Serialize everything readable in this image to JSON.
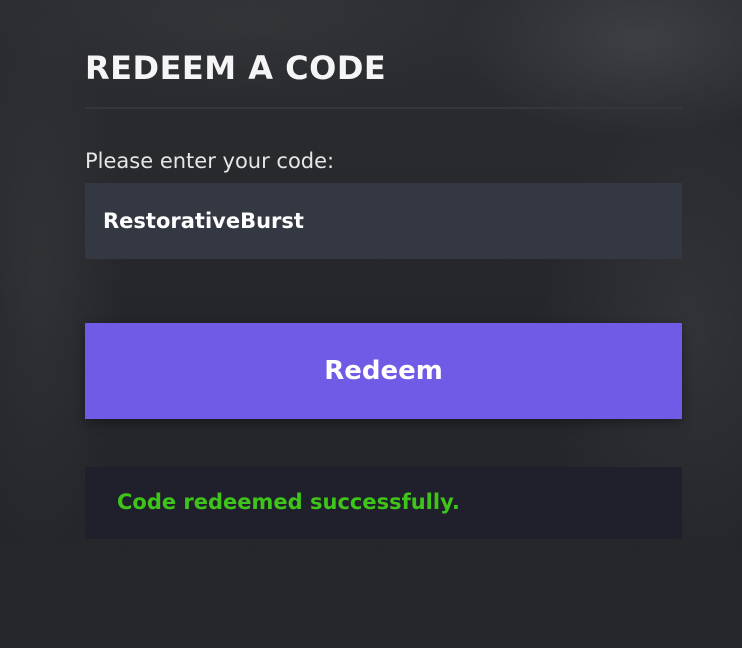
{
  "redeem": {
    "title": "REDEEM A CODE",
    "input_label": "Please enter your code:",
    "code_value": "RestorativeBurst",
    "button_label": "Redeem",
    "status_message": "Code redeemed successfully."
  },
  "colors": {
    "button_bg": "#705be6",
    "success_text": "#3fc41a",
    "input_bg": "#343843",
    "status_bg": "#20202c"
  }
}
